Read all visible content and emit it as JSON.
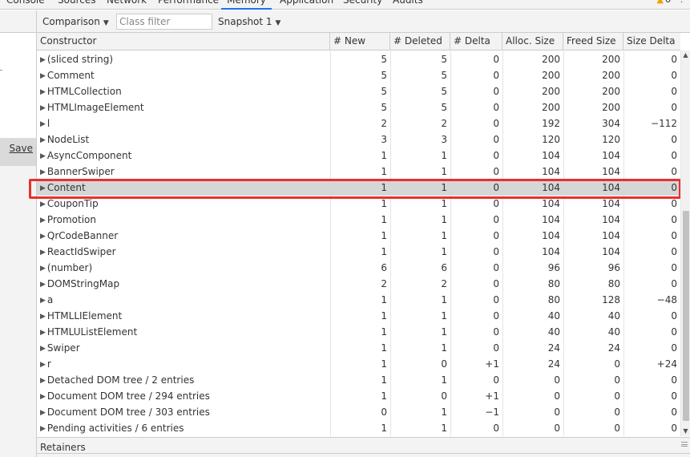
{
  "tabs": [
    {
      "label": "Console",
      "active": false
    },
    {
      "label": "Sources",
      "active": false
    },
    {
      "label": "Network",
      "active": false
    },
    {
      "label": "Performance",
      "active": false
    },
    {
      "label": "Memory",
      "active": true
    },
    {
      "label": "Application",
      "active": false
    },
    {
      "label": "Security",
      "active": false
    },
    {
      "label": "Audits",
      "active": false
    }
  ],
  "warnings": {
    "count": "6"
  },
  "toolbar": {
    "view_mode": "Comparison",
    "class_filter_placeholder": "Class filter",
    "snapshot": "Snapshot 1"
  },
  "left_panel": {
    "save_label": "Save"
  },
  "table": {
    "columns": [
      "Constructor",
      "# New",
      "# Deleted",
      "# Delta",
      "Alloc. Size",
      "Freed Size",
      "Size Delta"
    ],
    "rows": [
      {
        "name": "(sliced string)",
        "new": "5",
        "deleted": "5",
        "delta": "0",
        "alloc": "200",
        "freed": "200",
        "size_delta": "0"
      },
      {
        "name": "Comment",
        "new": "5",
        "deleted": "5",
        "delta": "0",
        "alloc": "200",
        "freed": "200",
        "size_delta": "0"
      },
      {
        "name": "HTMLCollection",
        "new": "5",
        "deleted": "5",
        "delta": "0",
        "alloc": "200",
        "freed": "200",
        "size_delta": "0"
      },
      {
        "name": "HTMLImageElement",
        "new": "5",
        "deleted": "5",
        "delta": "0",
        "alloc": "200",
        "freed": "200",
        "size_delta": "0"
      },
      {
        "name": "l",
        "new": "2",
        "deleted": "2",
        "delta": "0",
        "alloc": "192",
        "freed": "304",
        "size_delta": "−112"
      },
      {
        "name": "NodeList",
        "new": "3",
        "deleted": "3",
        "delta": "0",
        "alloc": "120",
        "freed": "120",
        "size_delta": "0"
      },
      {
        "name": "AsyncComponent",
        "new": "1",
        "deleted": "1",
        "delta": "0",
        "alloc": "104",
        "freed": "104",
        "size_delta": "0"
      },
      {
        "name": "BannerSwiper",
        "new": "1",
        "deleted": "1",
        "delta": "0",
        "alloc": "104",
        "freed": "104",
        "size_delta": "0"
      },
      {
        "name": "Content",
        "new": "1",
        "deleted": "1",
        "delta": "0",
        "alloc": "104",
        "freed": "104",
        "size_delta": "0",
        "selected": true
      },
      {
        "name": "CouponTip",
        "new": "1",
        "deleted": "1",
        "delta": "0",
        "alloc": "104",
        "freed": "104",
        "size_delta": "0"
      },
      {
        "name": "Promotion",
        "new": "1",
        "deleted": "1",
        "delta": "0",
        "alloc": "104",
        "freed": "104",
        "size_delta": "0"
      },
      {
        "name": "QrCodeBanner",
        "new": "1",
        "deleted": "1",
        "delta": "0",
        "alloc": "104",
        "freed": "104",
        "size_delta": "0"
      },
      {
        "name": "ReactIdSwiper",
        "new": "1",
        "deleted": "1",
        "delta": "0",
        "alloc": "104",
        "freed": "104",
        "size_delta": "0"
      },
      {
        "name": "(number)",
        "new": "6",
        "deleted": "6",
        "delta": "0",
        "alloc": "96",
        "freed": "96",
        "size_delta": "0"
      },
      {
        "name": "DOMStringMap",
        "new": "2",
        "deleted": "2",
        "delta": "0",
        "alloc": "80",
        "freed": "80",
        "size_delta": "0"
      },
      {
        "name": "a",
        "new": "1",
        "deleted": "1",
        "delta": "0",
        "alloc": "80",
        "freed": "128",
        "size_delta": "−48"
      },
      {
        "name": "HTMLLIElement",
        "new": "1",
        "deleted": "1",
        "delta": "0",
        "alloc": "40",
        "freed": "40",
        "size_delta": "0"
      },
      {
        "name": "HTMLUListElement",
        "new": "1",
        "deleted": "1",
        "delta": "0",
        "alloc": "40",
        "freed": "40",
        "size_delta": "0"
      },
      {
        "name": "Swiper",
        "new": "1",
        "deleted": "1",
        "delta": "0",
        "alloc": "24",
        "freed": "24",
        "size_delta": "0"
      },
      {
        "name": "r",
        "new": "1",
        "deleted": "0",
        "delta": "+1",
        "alloc": "24",
        "freed": "0",
        "size_delta": "+24"
      },
      {
        "name": "Detached DOM tree / 2 entries",
        "new": "1",
        "deleted": "1",
        "delta": "0",
        "alloc": "0",
        "freed": "0",
        "size_delta": "0"
      },
      {
        "name": "Document DOM tree / 294 entries",
        "new": "1",
        "deleted": "0",
        "delta": "+1",
        "alloc": "0",
        "freed": "0",
        "size_delta": "0"
      },
      {
        "name": "Document DOM tree / 303 entries",
        "new": "0",
        "deleted": "1",
        "delta": "−1",
        "alloc": "0",
        "freed": "0",
        "size_delta": "0"
      },
      {
        "name": "Pending activities / 6 entries",
        "new": "1",
        "deleted": "1",
        "delta": "0",
        "alloc": "0",
        "freed": "0",
        "size_delta": "0"
      }
    ]
  },
  "retainers": {
    "label": "Retainers"
  },
  "colors": {
    "highlight": "#e5322d",
    "selected_row": "#d6d6d6",
    "active_tab": "#1a73e8"
  }
}
